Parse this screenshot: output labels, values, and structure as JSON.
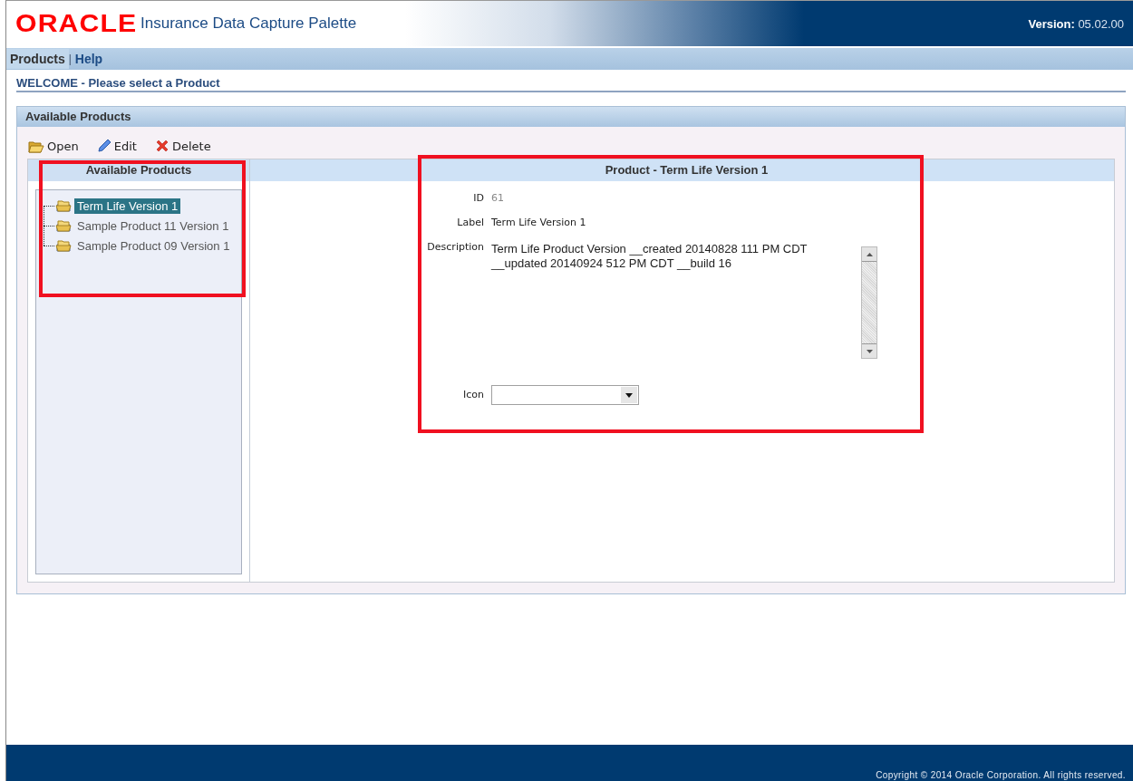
{
  "header": {
    "logo": "ORACLE",
    "title": "Insurance Data Capture Palette",
    "version": "**Version:** 05.02.00"
  },
  "nav": {
    "separator": "|",
    "items": [
      {
        "label": "Products",
        "selected": true
      },
      {
        "label": "Help",
        "selected": false
      }
    ]
  },
  "welcome": "WELCOME - Please select a Product",
  "panel": {
    "title": "Available Products",
    "toolbar": [
      {
        "kind": "open",
        "label": "Open"
      },
      {
        "kind": "edit",
        "label": "Edit"
      },
      {
        "kind": "delete",
        "label": "Delete"
      }
    ],
    "tree": {
      "title": "Available Products",
      "highlighted": true,
      "items": [
        {
          "label": "Term Life Version 1",
          "selected": true
        },
        {
          "label": "Sample Product 11 Version 1",
          "selected": false
        },
        {
          "label": "Sample Product 09 Version 1",
          "selected": false
        }
      ]
    },
    "details": {
      "title": "Product - Term Life Version 1",
      "highlighted": true,
      "fields": [
        {
          "kind": "readonly",
          "label": "ID",
          "value": "61"
        },
        {
          "kind": "text",
          "label": "Label",
          "value": "Term Life Version 1"
        },
        {
          "kind": "textarea",
          "label": "Description",
          "value": "Term Life Product Version __created 20140828 111 PM CDT __updated 20140924 512 PM CDT __build 16"
        },
        {
          "kind": "select",
          "label": "Icon"
        }
      ]
    }
  },
  "footer": "Copyright © 2014 Oracle Corporation. All rights reserved."
}
